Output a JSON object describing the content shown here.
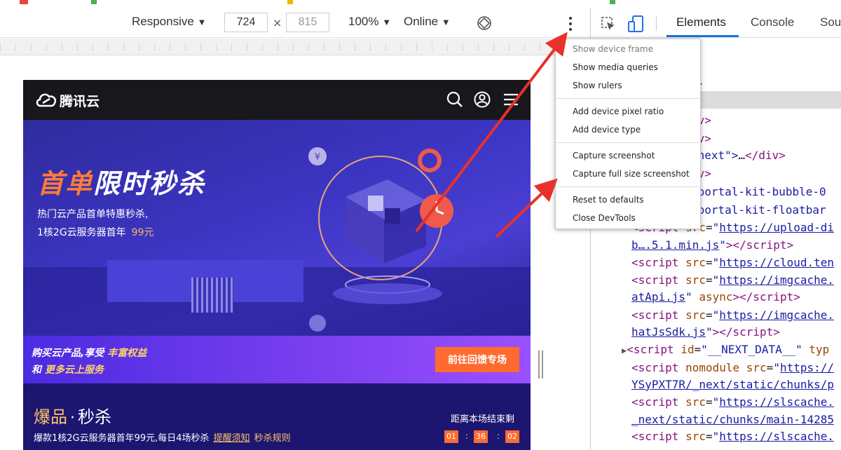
{
  "toolbar": {
    "device_mode": "Responsive",
    "width_value": "724",
    "height_value": "815",
    "zoom": "100%",
    "throttling": "Online",
    "dropdown_glyph": "▼",
    "times_glyph": "×"
  },
  "devtools": {
    "tabs": [
      "Elements",
      "Console",
      "Sou"
    ],
    "active_tab": "Elements"
  },
  "menu": {
    "items": [
      {
        "label": "Show device frame",
        "disabled": true
      },
      {
        "label": "Show media queries",
        "disabled": false
      },
      {
        "label": "Show rulers",
        "disabled": false
      },
      {
        "label": "Add device pixel ratio",
        "disabled": false
      },
      {
        "label": "Add device type",
        "disabled": false
      },
      {
        "label": "Capture screenshot",
        "disabled": false
      },
      {
        "label": "Capture full size screenshot",
        "disabled": false
      },
      {
        "label": "Reset to defaults",
        "disabled": false
      },
      {
        "label": "Close DevTools",
        "disabled": false
      }
    ]
  },
  "code_lines": {
    "l1": "l>",
    "l2": "d>",
    "l3": "iv>",
    "l4": "iv>",
    "l5a": "_next\">",
    "l5b": "…",
    "l5c": "</div>",
    "l6": "iv>",
    "l7": "cportal-kit-bubble-0",
    "l8": "cportal-kit-floatbar",
    "l9_url": "https://upload-di",
    "l10_url": "b….5.1.min.js",
    "l11_url": "https://cloud.ten",
    "l12_url": "https://imgcache.",
    "l13_url": "atApi.js",
    "l13_attr": "async",
    "l14_url": "https://imgcache.",
    "l15_url": "hatJsSdk.js",
    "l16_id": "__NEXT_DATA__",
    "l16_attr": "typ",
    "l17_attr": "nomodule src",
    "l17_url": "https://",
    "l18_url": "YSyPXT7R/_next/static/chunks/p",
    "l19_url": "https://slscache.",
    "l20_url": "_next/static/chunks/main-14285",
    "l21_url": "https://slscache."
  },
  "site": {
    "logo_text": "腾讯云",
    "banner_title_a": "首单",
    "banner_title_b": "限时秒杀",
    "banner_sub1": "热门云产品首单特惠秒杀,",
    "banner_sub2": "1核2G云服务器首年",
    "banner_price": "99元",
    "promo_l1_a": "购买云产品,享受",
    "promo_l1_b": "丰富权益",
    "promo_l2_a": "和",
    "promo_l2_b": "更多云上服务",
    "promo_button": "前往回馈专场",
    "flash_title_a": "爆品",
    "flash_title_sep": "·",
    "flash_title_b": "秒杀",
    "flash_desc": "爆款1核2G云服务器首年99元,每日4场秒杀",
    "flash_link1": "提醒须知",
    "flash_link2": "秒杀规则",
    "countdown_label": "距离本场结束剩",
    "countdown": [
      "01",
      "36",
      "02"
    ]
  },
  "colors": {
    "accent_orange": "#ff6b2f",
    "devtools_blue": "#1a73e8",
    "annotation_red": "#e8312a"
  }
}
